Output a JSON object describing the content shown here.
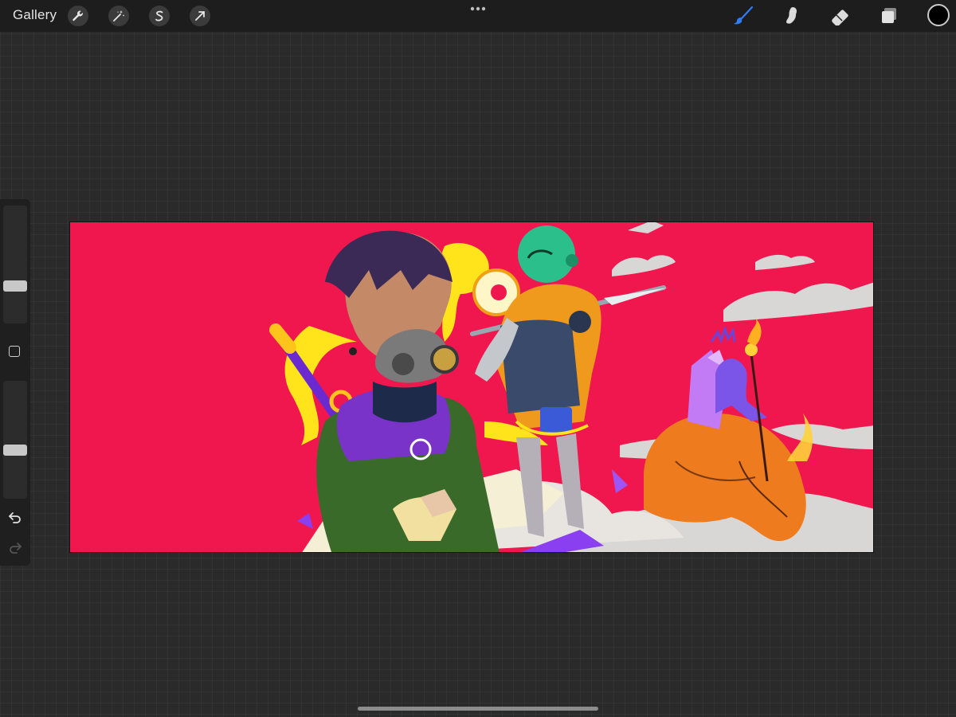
{
  "topbar": {
    "gallery_label": "Gallery",
    "left_tools": [
      {
        "name": "actions",
        "icon": "wrench-icon"
      },
      {
        "name": "adjustments",
        "icon": "magic-wand-icon"
      },
      {
        "name": "selection",
        "icon": "selection-s-icon"
      },
      {
        "name": "transform",
        "icon": "arrow-cursor-icon"
      }
    ],
    "more_icon": "ellipsis-icon",
    "right_tools": [
      {
        "name": "brush",
        "icon": "brush-icon",
        "active": true
      },
      {
        "name": "smudge",
        "icon": "smudge-icon",
        "active": false
      },
      {
        "name": "eraser",
        "icon": "eraser-icon",
        "active": false
      },
      {
        "name": "layers",
        "icon": "layers-icon",
        "active": false
      }
    ],
    "current_color": "#000000",
    "active_color": "#2f7cf6"
  },
  "sidebar": {
    "brush_size_level": 0.3,
    "opacity_level": 0.4,
    "modify_icon": "square-modify-icon",
    "undo_icon": "undo-icon",
    "redo_icon": "redo-icon"
  },
  "canvas": {
    "artwork": "illustration",
    "background_color": "#f0174f"
  }
}
